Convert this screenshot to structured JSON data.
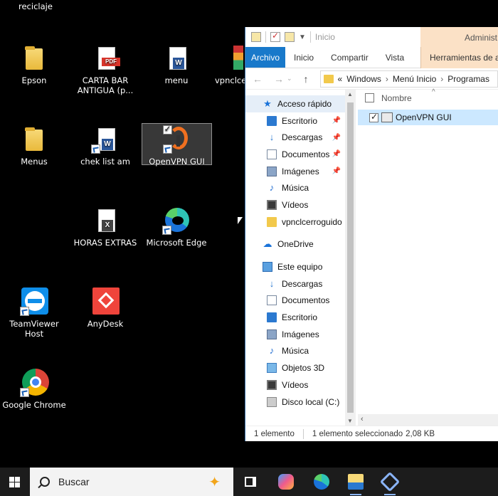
{
  "desktop": {
    "partial_top_label": "reciclaje",
    "icons": [
      {
        "label": "Epson"
      },
      {
        "label": "CARTA BAR ANTIGUA (p..."
      },
      {
        "label": "menu"
      },
      {
        "label": "vpnclce"
      },
      {
        "label": "Menus"
      },
      {
        "label": "chek list am"
      },
      {
        "label": "OpenVPN GUI"
      },
      {
        "label": "HORAS EXTRAS"
      },
      {
        "label": "Microsoft Edge"
      },
      {
        "label": "TeamViewer Host"
      },
      {
        "label": "AnyDesk"
      },
      {
        "label": "Google Chrome"
      }
    ]
  },
  "explorer": {
    "title": "Inicio",
    "admin_tab": "Administ",
    "ribbon": {
      "file": "Archivo",
      "home": "Inicio",
      "share": "Compartir",
      "view": "Vista",
      "tools": "Herramientas de ac"
    },
    "address": [
      "Windows",
      "Menú Inicio",
      "Programas"
    ],
    "address_prefix": "«",
    "nav": {
      "quick_access": "Acceso rápido",
      "quick_items": [
        "Escritorio",
        "Descargas",
        "Documentos",
        "Imágenes",
        "Música",
        "Vídeos",
        "vpnclcerroguido"
      ],
      "onedrive": "OneDrive",
      "this_pc": "Este equipo",
      "pc_items": [
        "Descargas",
        "Documentos",
        "Escritorio",
        "Imágenes",
        "Música",
        "Objetos 3D",
        "Vídeos",
        "Disco local (C:)"
      ]
    },
    "column_name": "Nombre",
    "files": [
      {
        "name": "OpenVPN GUI"
      }
    ],
    "status": {
      "count": "1 elemento",
      "selected": "1 elemento seleccionado",
      "size": "2,08 KB"
    }
  },
  "taskbar": {
    "search_placeholder": "Buscar"
  },
  "colors": {
    "accent": "#1979ca",
    "selection": "#cce8ff",
    "tools_tab": "#fbe1c6",
    "taskbar": "#1c1c1c"
  }
}
